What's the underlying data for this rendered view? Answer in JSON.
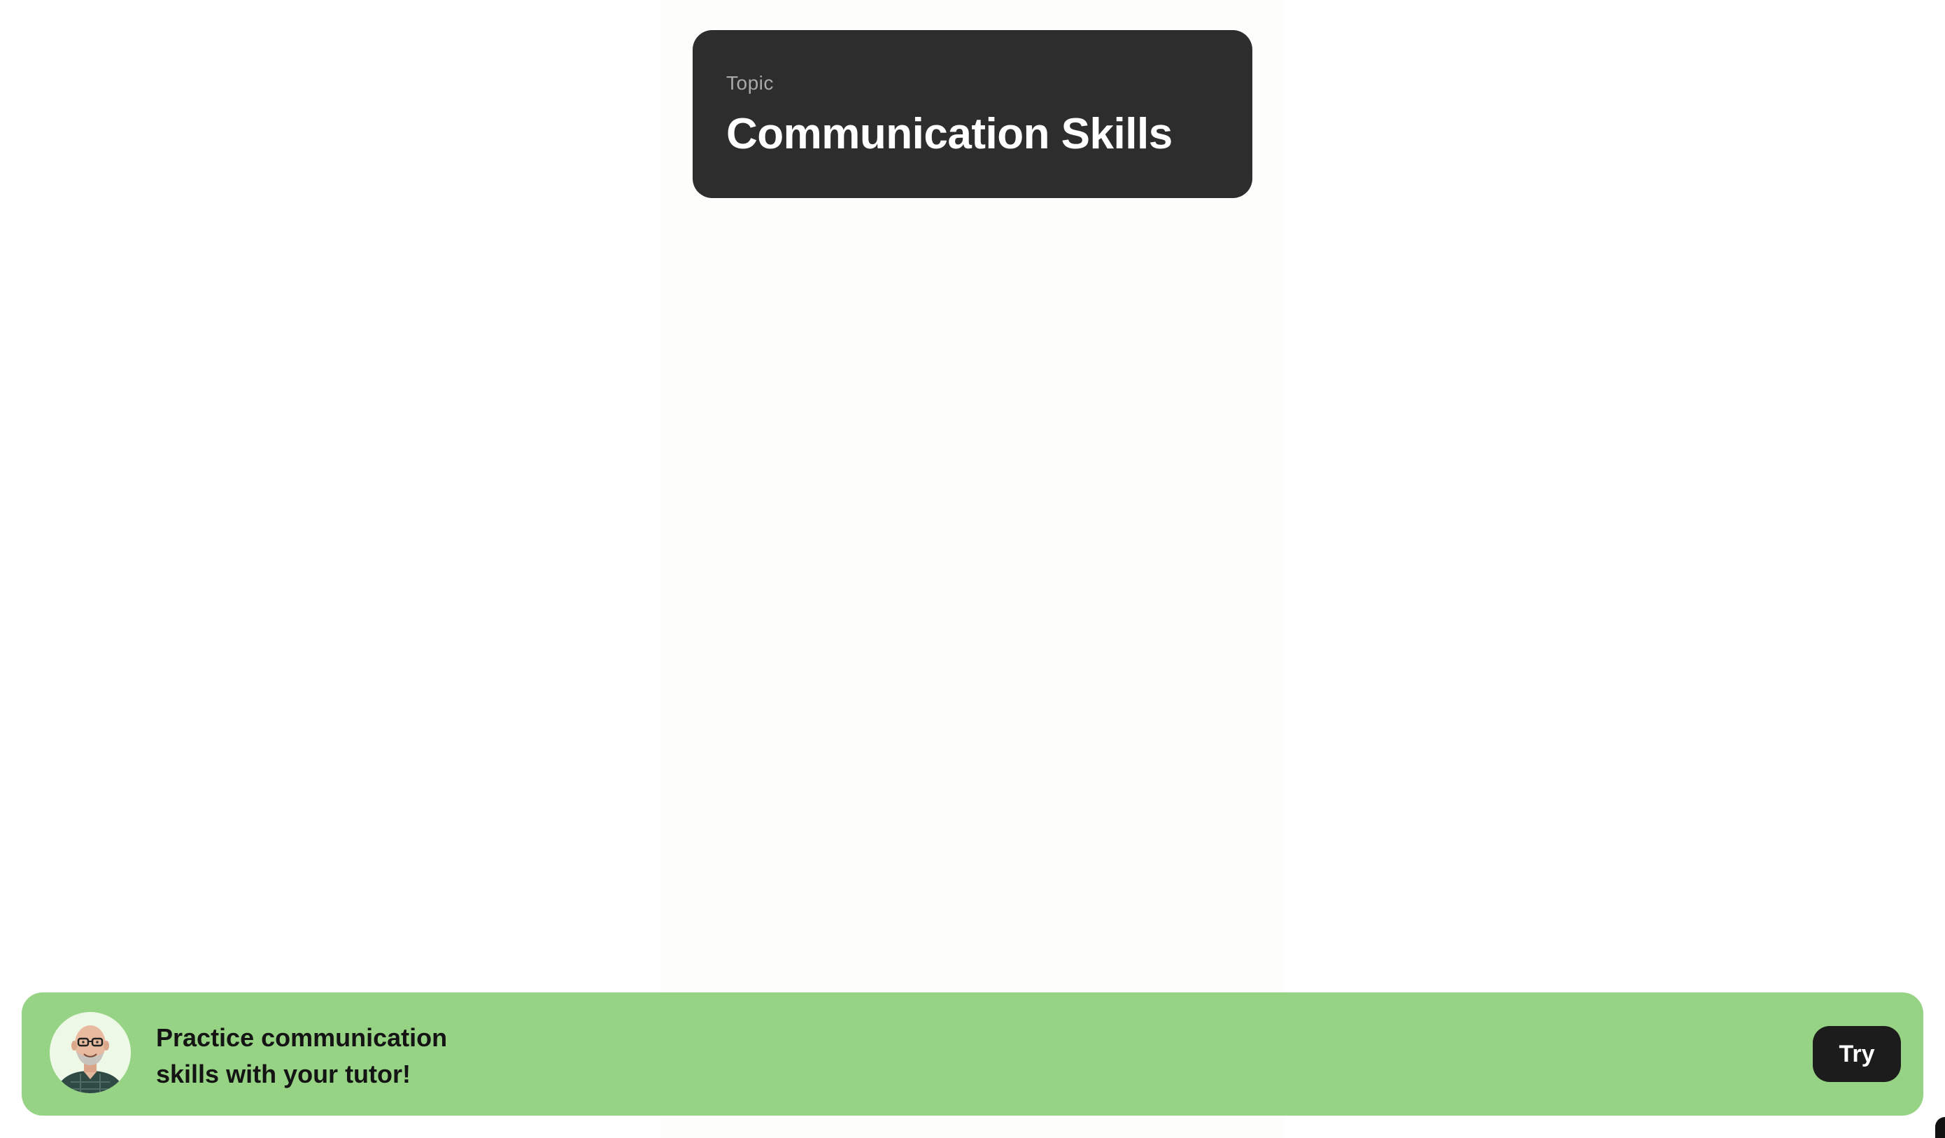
{
  "topic_card": {
    "label": "Topic",
    "title": "Communication Skills"
  },
  "promo": {
    "line1": "Practice communication",
    "line2": "skills with your tutor!",
    "button_label": "Try",
    "avatar_icon": "tutor-avatar-icon"
  },
  "colors": {
    "card_background": "#2d2d2d",
    "banner_background": "#97d384",
    "button_background": "#1c1c1c"
  }
}
